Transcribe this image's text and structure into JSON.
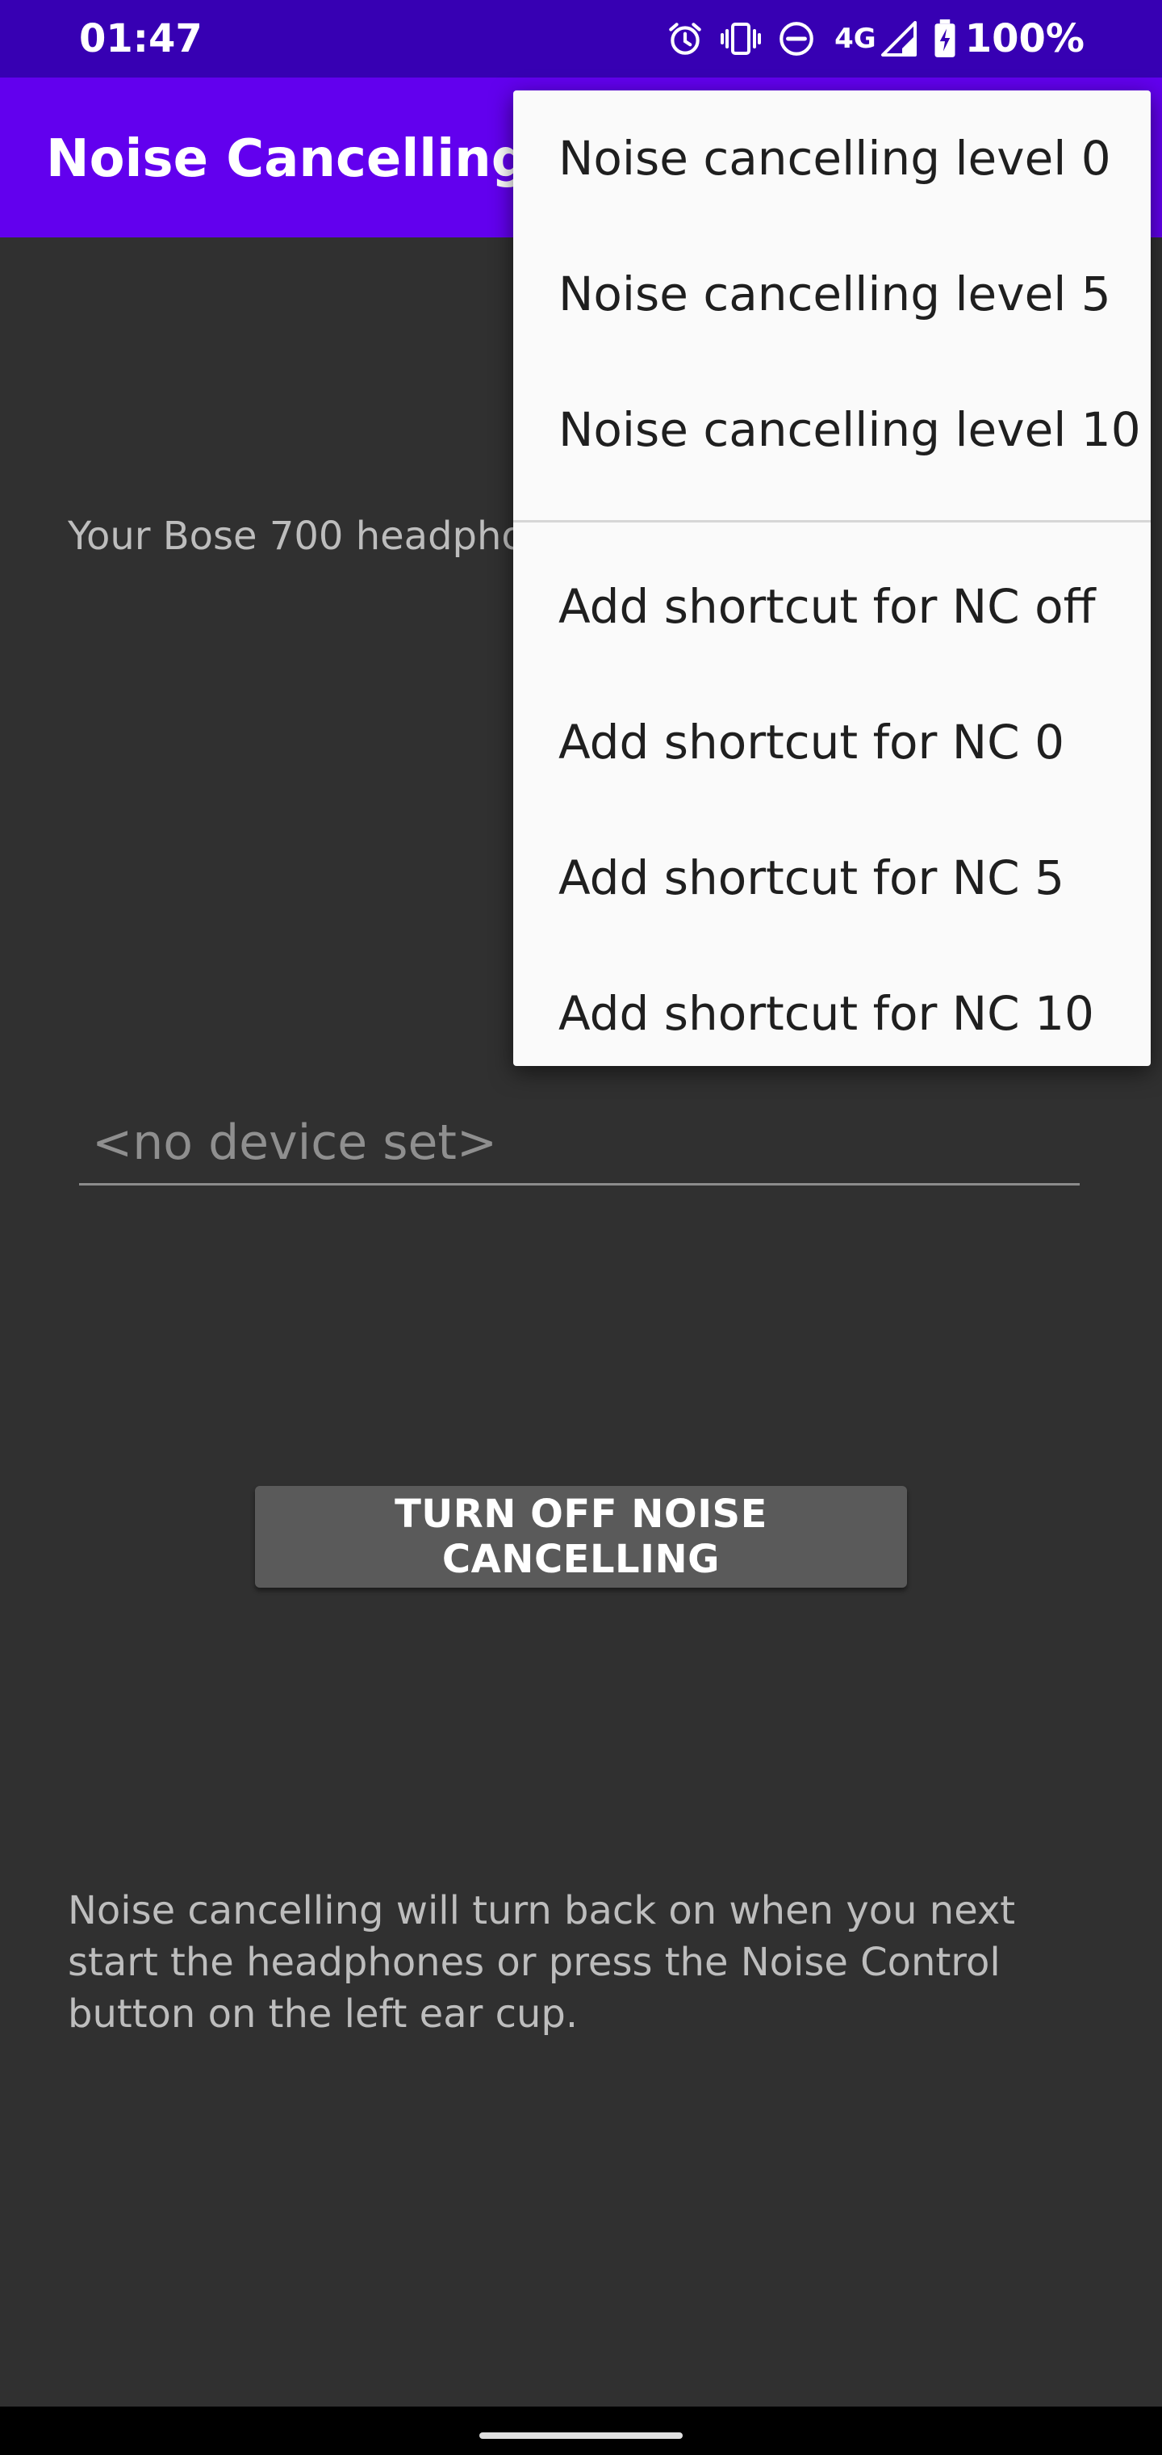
{
  "status_bar": {
    "time": "01:47",
    "network_label": "4G",
    "battery": "100%",
    "icons": [
      "alarm-icon",
      "vibrate-icon",
      "do-not-disturb-icon",
      "signal-icon",
      "battery-charging-icon"
    ]
  },
  "app_bar": {
    "title": "Noise Cancelling"
  },
  "main": {
    "device_intro": "Your Bose 700 headpho",
    "device_field_placeholder": "<no device set>",
    "turn_off_button": "TURN OFF NOISE CANCELLING",
    "footer_note": "Noise cancelling will turn back on when you next start the headphones or press the Noise Control button on the left ear cup."
  },
  "menu": {
    "level_items": [
      {
        "label": "Noise cancelling level 0"
      },
      {
        "label": "Noise cancelling level 5"
      },
      {
        "label": "Noise cancelling level 10"
      }
    ],
    "shortcut_items": [
      {
        "label": "Add shortcut for NC off"
      },
      {
        "label": "Add shortcut for NC 0"
      },
      {
        "label": "Add shortcut for NC 5"
      },
      {
        "label": "Add shortcut for NC 10"
      }
    ]
  },
  "colors": {
    "status_bar": "#3700b3",
    "app_bar": "#6200ee",
    "background": "#303030",
    "button": "#5a5a5a",
    "menu_background": "#fafafa"
  }
}
